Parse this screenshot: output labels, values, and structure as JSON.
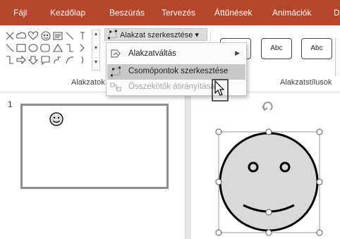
{
  "ribbon": {
    "tabs": [
      {
        "label": "Fájl"
      },
      {
        "label": "Kezdőlap"
      },
      {
        "label": "Beszúrás"
      },
      {
        "label": "Tervezés"
      },
      {
        "label": "Áttűnések"
      },
      {
        "label": "Animációk"
      },
      {
        "label": "D"
      }
    ],
    "groups": {
      "shapes": {
        "label": "Alakzatok"
      },
      "shape_styles": {
        "label": "Alakzatstílusok"
      }
    },
    "edit_shape_button": {
      "label": "Alakzat szerkesztése ▾"
    },
    "style_presets": [
      {
        "label": ""
      },
      {
        "label": "Abc"
      },
      {
        "label": "Abc"
      }
    ],
    "colors": {
      "tab_bar": "#b7472a",
      "tab_text": "#ffffff"
    }
  },
  "edit_shape_menu": {
    "items": [
      {
        "label": "Alakzatváltás",
        "icon": "change-shape-icon",
        "has_submenu": true,
        "state": "normal"
      },
      {
        "label": "Csomópontok szerkesztése",
        "icon": "edit-points-icon",
        "state": "hover"
      },
      {
        "label": "Összekötők átirányítása",
        "icon": "reroute-connectors-icon",
        "state": "disabled"
      }
    ]
  },
  "slides_pane": {
    "slides": [
      {
        "number": "1",
        "content_icon": "smiley-face-icon"
      }
    ]
  },
  "slide_canvas": {
    "selected_shape": {
      "type": "smiley-face",
      "fill": "#d9d9d9",
      "outline": "#000000",
      "handles": 8,
      "rotate_handle": true
    }
  }
}
